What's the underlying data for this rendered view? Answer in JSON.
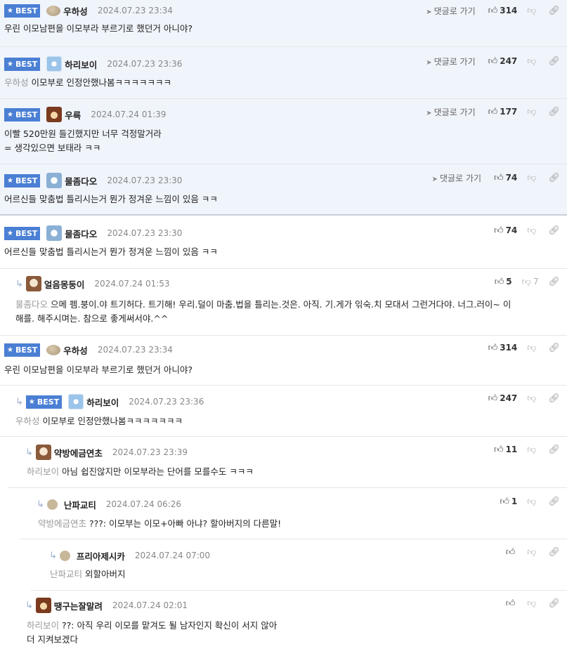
{
  "ui": {
    "best_label": "BEST",
    "goto_label": "댓글로 가기",
    "reply_arrow": "↳"
  },
  "comments": [
    {
      "nick": "우하성",
      "date": "2024.07.23 23:34",
      "mention": "",
      "text": "우린 이모남편을 이모부라 부르기로 했던거 아니야?",
      "text2": "",
      "likes": "314",
      "dislikes": "",
      "best": true
    },
    {
      "nick": "하리보이",
      "date": "2024.07.23 23:36",
      "mention": "우하성",
      "text": "이모부로 인정안했나봄ㅋㅋㅋㅋㅋㅋㅋ",
      "text2": "",
      "likes": "247",
      "dislikes": "",
      "best": true
    },
    {
      "nick": "우륵",
      "date": "2024.07.24 01:39",
      "mention": "",
      "text": "이빨 520만원 들긴했지만 너무 걱정말거라",
      "text2": "= 생각있으면 보태라 ㅋㅋ",
      "likes": "177",
      "dislikes": "",
      "best": true
    },
    {
      "nick": "물좀다오",
      "date": "2024.07.23 23:30",
      "mention": "",
      "text": "어르신들 맞춤법 틀리시는거 뭔가 정겨운 느낌이 있음 ㅋㅋ",
      "text2": "",
      "likes": "74",
      "dislikes": "",
      "best": true
    },
    {
      "nick": "물좀다오",
      "date": "2024.07.23 23:30",
      "mention": "",
      "text": "어르신들 맞춤법 틀리시는거 뭔가 정겨운 느낌이 있음 ㅋㅋ",
      "text2": "",
      "likes": "74",
      "dislikes": "",
      "best": true
    },
    {
      "nick": "얼음몽둥이",
      "date": "2024.07.24 01:53",
      "mention": "물좀다오",
      "text": "으메 펨.붕이.야 트기허다. 트기해! 우리.덜이 마춤.법을 틀리는.것은. 아직. 기.게가 읶숙.치 모대서 그런거다야. 너그.러이~ 이",
      "text2": "해를. 해주시며는. 참으로 좋게써서야.^^",
      "likes": "5",
      "dislikes": "7",
      "best": false
    },
    {
      "nick": "우하성",
      "date": "2024.07.23 23:34",
      "mention": "",
      "text": "우린 이모남편을 이모부라 부르기로 했던거 아니야?",
      "text2": "",
      "likes": "314",
      "dislikes": "",
      "best": true
    },
    {
      "nick": "하리보이",
      "date": "2024.07.23 23:36",
      "mention": "우하성",
      "text": "이모부로 인정안했나봄ㅋㅋㅋㅋㅋㅋㅋ",
      "text2": "",
      "likes": "247",
      "dislikes": "",
      "best": true
    },
    {
      "nick": "약방에금연초",
      "date": "2024.07.23 23:39",
      "mention": "하리보이",
      "text": "아님 쉽진않지만 이모부라는 단어를 모를수도 ㅋㅋㅋ",
      "text2": "",
      "likes": "11",
      "dislikes": "",
      "best": false
    },
    {
      "nick": "난파교티",
      "date": "2024.07.24 06:26",
      "mention": "약방에금연초",
      "text": "???: 이모부는 이모+아빠 아냐? 할아버지의 다른말!",
      "text2": "",
      "likes": "1",
      "dislikes": "",
      "best": false
    },
    {
      "nick": "프리아제시카",
      "date": "2024.07.24 07:00",
      "mention": "난파교티",
      "text": "외할아버지",
      "text2": "",
      "likes": "",
      "dislikes": "",
      "best": false
    },
    {
      "nick": "땡구는잘말려",
      "date": "2024.07.24 02:01",
      "mention": "하리보이",
      "text": "??: 아직 우리 이모를 맡겨도 될 남자인지 확신이 서지 않아",
      "text2": "더 지켜보겠다",
      "likes": "",
      "dislikes": "",
      "best": false
    }
  ]
}
